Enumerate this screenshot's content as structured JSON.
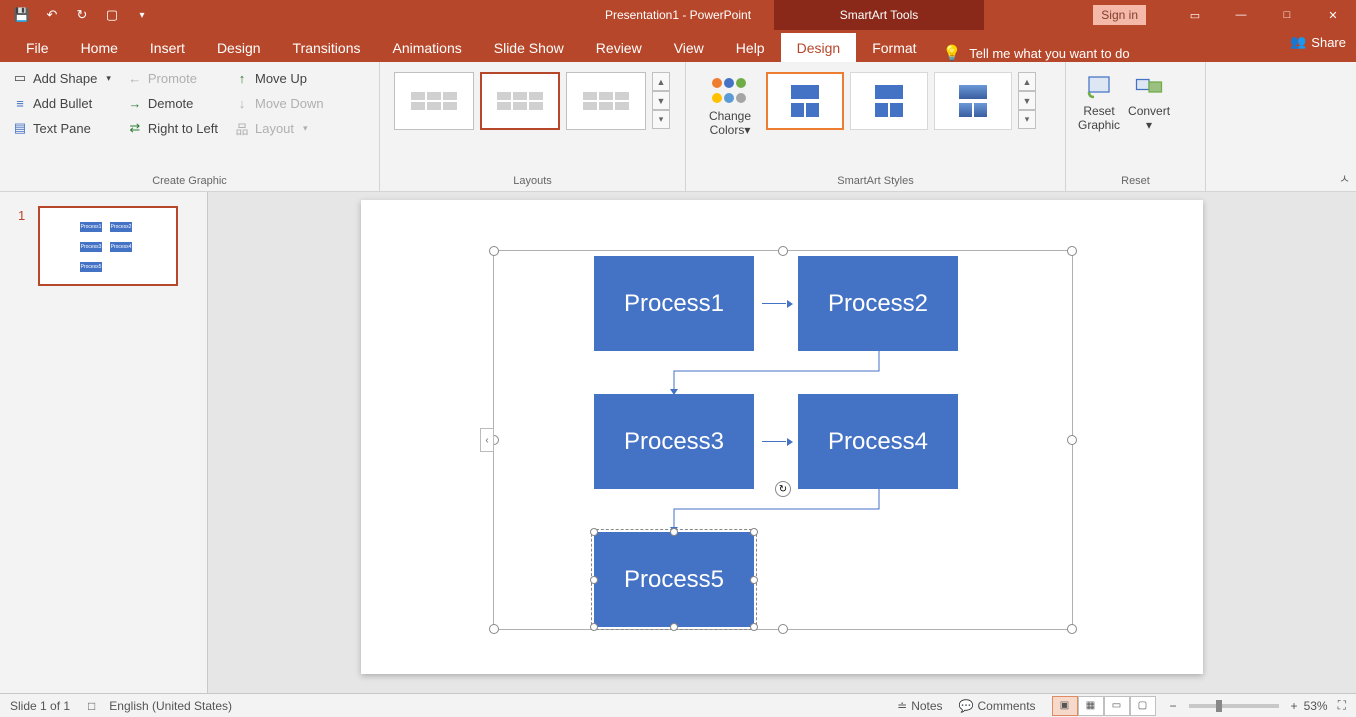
{
  "title": "Presentation1 - PowerPoint",
  "context_tab": "SmartArt Tools",
  "signin": "Sign in",
  "tabs": {
    "file": "File",
    "home": "Home",
    "insert": "Insert",
    "design": "Design",
    "transitions": "Transitions",
    "animations": "Animations",
    "slideshow": "Slide Show",
    "review": "Review",
    "view": "View",
    "help": "Help",
    "smartart_design": "Design",
    "smartart_format": "Format",
    "tellme": "Tell me what you want to do",
    "share": "Share"
  },
  "ribbon": {
    "create_graphic": {
      "label": "Create Graphic",
      "add_shape": "Add Shape",
      "add_bullet": "Add Bullet",
      "text_pane": "Text Pane",
      "promote": "Promote",
      "demote": "Demote",
      "rtl": "Right to Left",
      "move_up": "Move Up",
      "move_down": "Move Down",
      "layout": "Layout"
    },
    "layouts": {
      "label": "Layouts"
    },
    "styles": {
      "label": "SmartArt Styles",
      "change_colors": "Change Colors"
    },
    "reset": {
      "label": "Reset",
      "reset_graphic": "Reset Graphic",
      "convert": "Convert"
    }
  },
  "smartart": {
    "p1": "Process1",
    "p2": "Process2",
    "p3": "Process3",
    "p4": "Process4",
    "p5": "Process5"
  },
  "status": {
    "slide": "Slide 1 of 1",
    "lang": "English (United States)",
    "notes": "Notes",
    "comments": "Comments",
    "zoom": "53%"
  },
  "thumb_num": "1"
}
